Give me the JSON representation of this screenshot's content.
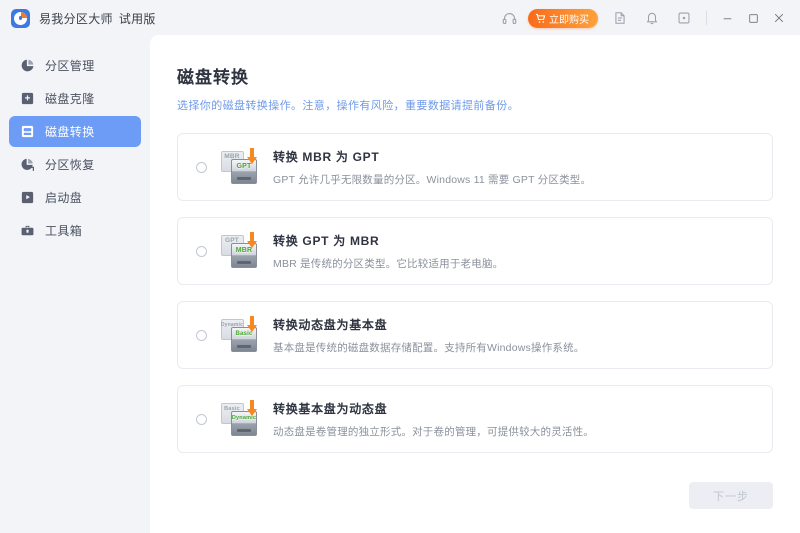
{
  "titlebar": {
    "app_name": "易我分区大师",
    "edition": "试用版",
    "logo_icon": "app-logo-icon",
    "icons": [
      {
        "name": "headset-icon",
        "glyph": "headset"
      },
      {
        "name": "feedback-icon",
        "glyph": "note"
      },
      {
        "name": "notification-bell-icon",
        "glyph": "bell"
      },
      {
        "name": "more-menu-icon",
        "glyph": "box-dot"
      }
    ],
    "buy_button": {
      "label": "立即购买",
      "icon": "shopping-cart-icon",
      "color": "#f9761f"
    },
    "window_controls": [
      {
        "name": "minimize-button",
        "glyph": "—"
      },
      {
        "name": "maximize-button",
        "glyph": "□"
      },
      {
        "name": "close-button",
        "glyph": "✕"
      }
    ]
  },
  "sidebar": {
    "active_index": 2,
    "active_color": "#6c9cf5",
    "items": [
      {
        "label": "分区管理",
        "icon": "pie-chart-icon"
      },
      {
        "label": "磁盘克隆",
        "icon": "disk-plus-icon"
      },
      {
        "label": "磁盘转换",
        "icon": "disk-convert-icon"
      },
      {
        "label": "分区恢复",
        "icon": "pie-recovery-icon"
      },
      {
        "label": "启动盘",
        "icon": "disk-boot-icon"
      },
      {
        "label": "工具箱",
        "icon": "toolbox-icon"
      }
    ]
  },
  "main": {
    "title": "磁盘转换",
    "subtitle": "选择你的磁盘转换操作。注意，操作有风险，重要数据请提前备份。",
    "subtitle_color": "#6f9ae8",
    "options": [
      {
        "title": "转换 MBR 为 GPT",
        "desc": "GPT 允许几乎无限数量的分区。Windows 11 需要 GPT 分区类型。",
        "icon": "disk-mbr-to-gpt-icon",
        "source_badge": "MBR",
        "target_badge": "GPT",
        "selected": false
      },
      {
        "title": "转换 GPT 为 MBR",
        "desc": "MBR 是传统的分区类型。它比较适用于老电脑。",
        "icon": "disk-gpt-to-mbr-icon",
        "source_badge": "GPT",
        "target_badge": "MBR",
        "selected": false
      },
      {
        "title": "转换动态盘为基本盘",
        "desc": "基本盘是传统的磁盘数据存储配置。支持所有Windows操作系统。",
        "icon": "disk-dynamic-to-basic-icon",
        "source_badge": "Dynamic",
        "target_badge": "Basic",
        "selected": false
      },
      {
        "title": "转换基本盘为动态盘",
        "desc": "动态盘是卷管理的独立形式。对于卷的管理，可提供较大的灵活性。",
        "icon": "disk-basic-to-dynamic-icon",
        "source_badge": "Basic",
        "target_badge": "Dynamic",
        "selected": false
      }
    ],
    "next_button": {
      "label": "下一步",
      "enabled": false
    }
  }
}
